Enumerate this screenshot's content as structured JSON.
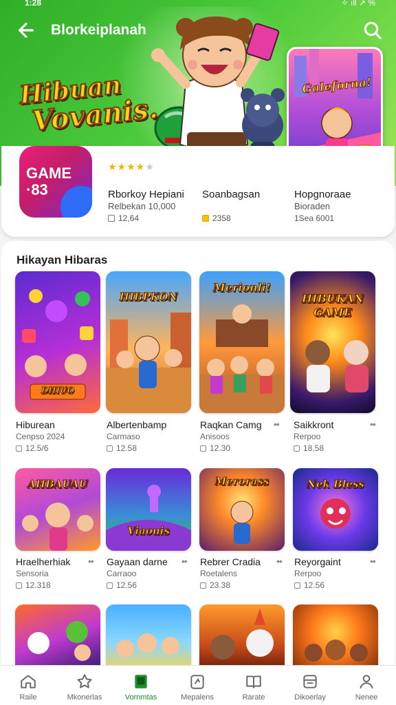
{
  "status": {
    "time": "1:28",
    "right": "✧ ıll ↗ %"
  },
  "header": {
    "title": "Blorkeiplanah"
  },
  "hero": {
    "logo_line1": "Hibuan",
    "logo_line2": "Vovanis.",
    "promo_title": "Galeforna!"
  },
  "featured": {
    "icon_text": "GAME\n·83",
    "stars": "★★★★",
    "stars_off": "★",
    "item1": {
      "title": "Rborkoy Hepiani",
      "subtitle": "Relbekan 10,000",
      "meta": "12,64"
    },
    "item2": {
      "title": "Soanbagsan",
      "meta": "2358"
    },
    "item3": {
      "title": "Hopgnoraae",
      "subtitle": "Bioraden",
      "meta": "1Sea 6001"
    }
  },
  "section": {
    "title": "Hikayan Hibaras",
    "games": [
      {
        "name": "Hiburean",
        "sub": "Cenpso 2024",
        "meta": "12.5/6",
        "label": "DHIUO"
      },
      {
        "name": "Albertenbamp",
        "sub": "Carmaso",
        "meta": "12.58",
        "label": "HIBPKON"
      },
      {
        "name": "Raqkan Camg",
        "sub": "Anisoos",
        "meta": "12.30",
        "label": "Merionli!"
      },
      {
        "name": "Saikkront",
        "sub": "Rerpoo",
        "meta": "18,58",
        "label": "HIBUKAN GAME"
      },
      {
        "name": "Hraelherhiak",
        "sub": "Sensoria",
        "meta": "12.318",
        "label": "AHBAUAU"
      },
      {
        "name": "Gayaan darne",
        "sub": "Carraoo",
        "meta": "12.56",
        "label": "Viaouis"
      },
      {
        "name": "Rebrer Cradia",
        "sub": "Roetalens",
        "meta": "23.38",
        "label": "Merorass"
      },
      {
        "name": "Reyorgaint",
        "sub": "Rerpoo",
        "meta": "12.56",
        "label": "Nek Bless"
      }
    ],
    "more_glyph": "••"
  },
  "bottom_nav": [
    {
      "label": "Raile",
      "icon": "home-icon"
    },
    {
      "label": "Mkonerlas",
      "icon": "star-icon"
    },
    {
      "label": "Vornmtas",
      "icon": "games-icon"
    },
    {
      "label": "Mepalens",
      "icon": "apps-icon"
    },
    {
      "label": "Rarate",
      "icon": "book-icon"
    },
    {
      "label": "Dikoerlay",
      "icon": "list-icon"
    },
    {
      "label": "Nenee",
      "icon": "person-icon"
    }
  ],
  "colors": {
    "accent": "#1e8e2e",
    "hero_green": "#49c93a"
  }
}
